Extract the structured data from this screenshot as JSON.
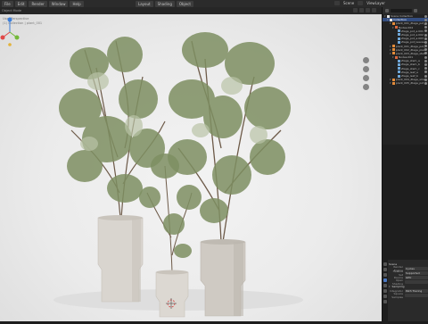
{
  "topbar": {
    "menus": [
      "File",
      "Edit",
      "Render",
      "Window",
      "Help"
    ],
    "mid": [
      "Layout",
      "Shading",
      "Object"
    ],
    "scene": "Scene",
    "view_layer": "ViewLayer"
  },
  "viewport": {
    "header_label": "Object Mode",
    "overlay_lines": [
      "User Perspective",
      "(1) Collection | plant_001"
    ],
    "background_color": "#eeeeee"
  },
  "outliner": {
    "title": "Scene Collection",
    "rows": [
      {
        "label": "Scene Collection",
        "level": 0,
        "icon": "coll",
        "selected": false
      },
      {
        "label": "Collection",
        "level": 1,
        "icon": "coll",
        "selected": true
      },
      {
        "label": "plant_001_Zlaga_pot_a",
        "level": 2,
        "icon": "obj",
        "selected": false
      },
      {
        "label": "Nodes.004",
        "level": 3,
        "icon": "mod",
        "selected": false
      },
      {
        "label": "Zlaga_pot_a.001",
        "level": 4,
        "icon": "mesh",
        "selected": false
      },
      {
        "label": "Zlaga_pot_a.002",
        "level": 4,
        "icon": "mesh",
        "selected": false
      },
      {
        "label": "Zlaga_pot_a.003",
        "level": 4,
        "icon": "mesh",
        "selected": false
      },
      {
        "label": "Zlaga_pot_leaves",
        "level": 4,
        "icon": "mesh",
        "selected": false
      },
      {
        "label": "plant_001_Zlaga_pot_b",
        "level": 2,
        "icon": "obj",
        "selected": false
      },
      {
        "label": "plant_002_Zlaga_plant",
        "level": 2,
        "icon": "obj",
        "selected": false
      },
      {
        "label": "plant_003_Zlaga_stem",
        "level": 2,
        "icon": "obj",
        "selected": false
      },
      {
        "label": "Nodes.001",
        "level": 3,
        "icon": "mod",
        "selected": false
      },
      {
        "label": "Zlaga_stem_a",
        "level": 4,
        "icon": "mesh",
        "selected": false
      },
      {
        "label": "Zlaga_stem_b",
        "level": 4,
        "icon": "mesh",
        "selected": false
      },
      {
        "label": "Zlaga_stem_c",
        "level": 4,
        "icon": "mesh",
        "selected": false
      },
      {
        "label": "Zlaga_leaf_a",
        "level": 4,
        "icon": "mesh",
        "selected": false
      },
      {
        "label": "Zlaga_leaf_b",
        "level": 4,
        "icon": "mesh",
        "selected": false
      },
      {
        "label": "plant_004_Zlaga_small",
        "level": 2,
        "icon": "obj",
        "selected": false
      },
      {
        "label": "plant_005_Zlaga_pot",
        "level": 2,
        "icon": "obj",
        "selected": false
      }
    ]
  },
  "properties": {
    "title": "Scene",
    "rows": [
      {
        "key": "Render Engine",
        "value": "Cycles"
      },
      {
        "key": "Feature Set",
        "value": "Supported"
      },
      {
        "key": "Device",
        "value": "GPU"
      },
      {
        "key": "Open Shading",
        "value": ""
      }
    ],
    "section": "Sampling",
    "section_rows": [
      {
        "key": "Integrator",
        "value": "Path Tracing"
      },
      {
        "key": "Square Samples",
        "value": ""
      }
    ]
  },
  "colors": {
    "selection": "#334d80",
    "accent_orange": "#e38b3a",
    "gizmo_x": "#e04848",
    "gizmo_y": "#74b93a",
    "gizmo_z": "#3d7fd9"
  }
}
